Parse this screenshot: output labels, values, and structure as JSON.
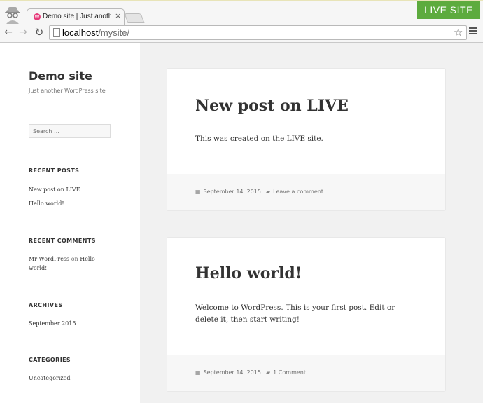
{
  "browser": {
    "tab_title": "Demo site | Just another W",
    "tab_favicon": "W",
    "tab_close": "×",
    "url_host": "localhost",
    "url_path": "/mysite/",
    "live_badge": "LIVE SITE",
    "back_icon": "←",
    "forward_icon": "→",
    "reload_icon": "↻",
    "star_icon": "☆"
  },
  "site": {
    "title": "Demo site",
    "description": "Just another WordPress site",
    "search_placeholder": "Search …"
  },
  "widgets": {
    "recent_posts": {
      "title": "RECENT POSTS",
      "items": [
        "New post on LIVE",
        "Hello world!"
      ]
    },
    "recent_comments": {
      "title": "RECENT COMMENTS",
      "author": "Mr WordPress",
      "on": "on",
      "post_line1": "Hello",
      "post_line2": "world!"
    },
    "archives": {
      "title": "ARCHIVES",
      "items": [
        "September 2015"
      ]
    },
    "categories": {
      "title": "CATEGORIES",
      "items": [
        "Uncategorized"
      ]
    }
  },
  "posts": [
    {
      "title": "New post on LIVE",
      "body": "This was created on the LIVE site.",
      "date": "September 14, 2015",
      "comments": "Leave a comment"
    },
    {
      "title": "Hello world!",
      "body": "Welcome to WordPress. This is your first post. Edit or delete it, then start writing!",
      "date": "September 14, 2015",
      "comments": "1 Comment"
    }
  ],
  "icons": {
    "date": "calendar-icon",
    "comment": "comment-bubble-icon",
    "incognito": "incognito-icon",
    "menu": "hamburger-menu-icon"
  },
  "colors": {
    "live_badge": "#5dab3e",
    "page_bg": "#f1f1f1",
    "text": "#333333"
  }
}
